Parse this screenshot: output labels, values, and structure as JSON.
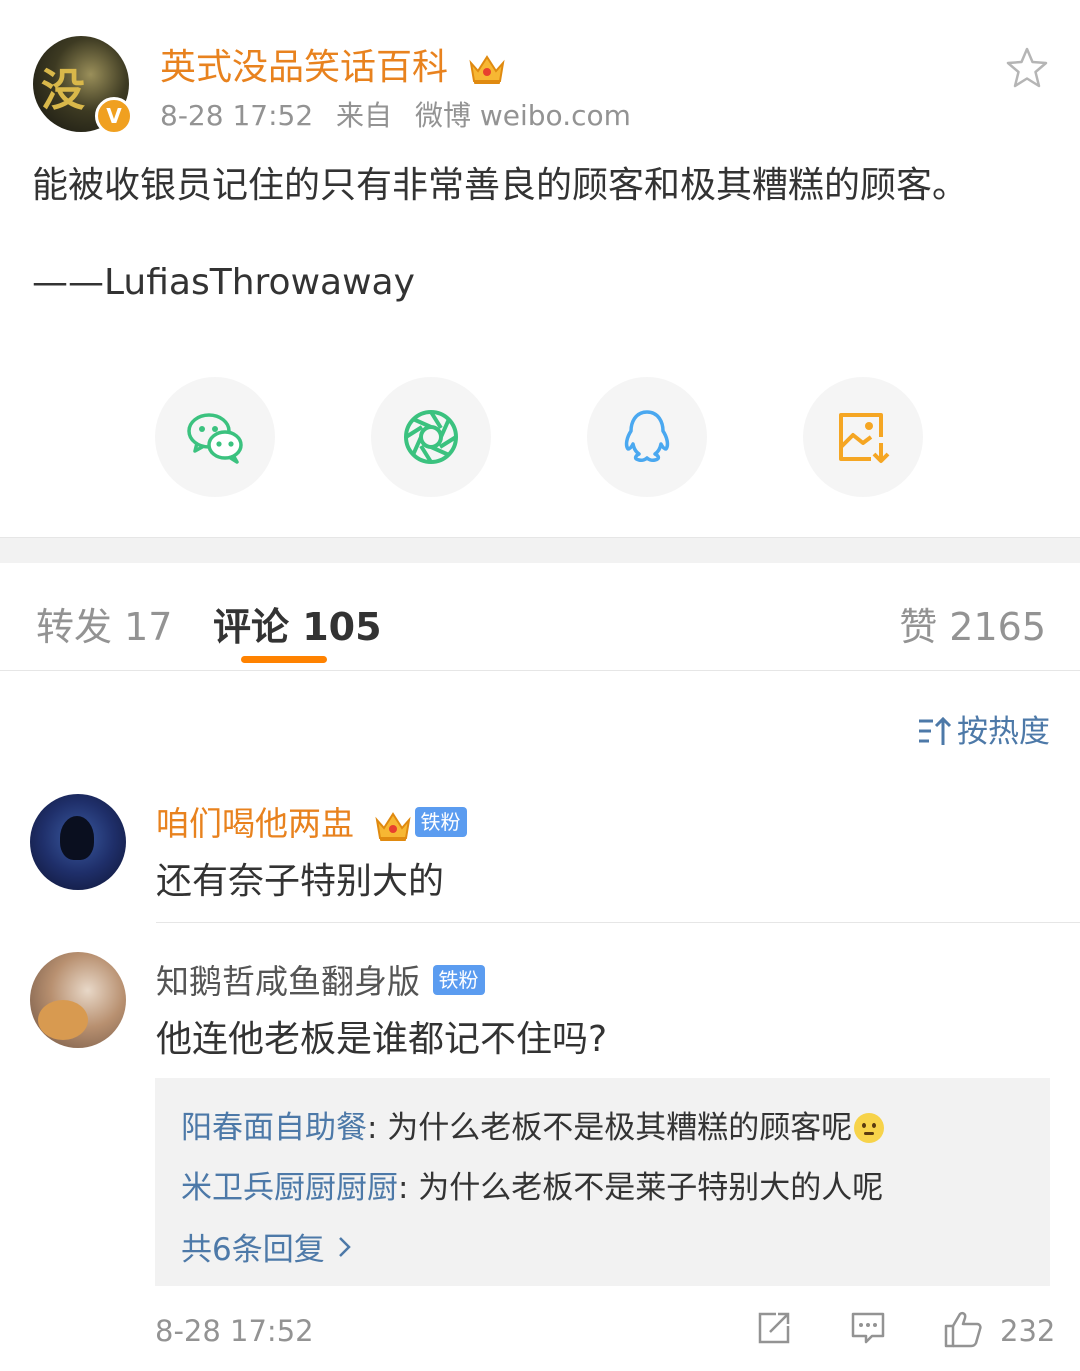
{
  "post": {
    "author": "英式没品笑话百科",
    "avatar_text": "没",
    "verified_mark": "V",
    "time": "8-28 17:52",
    "source_prefix": "来自",
    "source": "微博 weibo.com",
    "text": "能被收银员记住的只有非常善良的顾客和极其糟糕的顾客。",
    "attribution": "——LufiasThrowaway"
  },
  "share": [
    {
      "icon": "wechat-icon",
      "color": "#3bc27f"
    },
    {
      "icon": "moments-icon",
      "color": "#3bc27f"
    },
    {
      "icon": "qq-icon",
      "color": "#4aa8f0"
    },
    {
      "icon": "save-image-icon",
      "color": "#f5a623"
    }
  ],
  "tabs": {
    "repost": "转发 17",
    "comments": "评论 105",
    "likes": "赞 2165"
  },
  "sort": {
    "label": "按热度"
  },
  "comments": [
    {
      "name": "咱们喝他两盅",
      "badge": "铁粉",
      "text": "还有奈子特别大的"
    },
    {
      "name": "知鹅哲咸鱼翻身版",
      "badge": "铁粉",
      "text": "他连他老板是谁都记不住吗?",
      "replies": [
        {
          "name": "阳春面自助餐",
          "text": ": 为什么老板不是极其糟糕的顾客呢"
        },
        {
          "name": "米卫兵厨厨厨厨",
          "text": ": 为什么老板不是莱子特别大的人呢"
        }
      ],
      "more_replies": "共6条回复",
      "time": "8-28 17:52",
      "likes": "232"
    }
  ],
  "colors": {
    "accent": "#ff8200",
    "author_orange": "#e8821e",
    "link_blue": "#4d79a8",
    "badge_blue": "#5b9cf0"
  }
}
